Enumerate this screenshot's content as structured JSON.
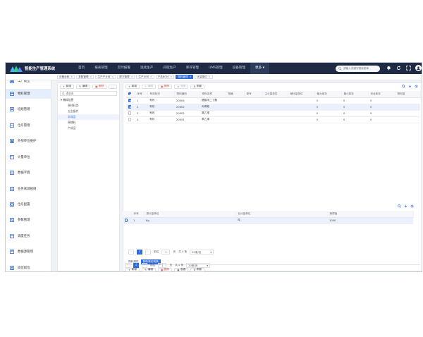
{
  "app": {
    "title": "智能生产管理系统"
  },
  "nav": [
    "首页",
    "报表管理",
    "实时报警",
    "连续生产",
    "间歇生产",
    "库存管理",
    "UMS管理",
    "设备管理",
    "更多"
  ],
  "search": {
    "placeholder": "请输入关键字搜索菜单"
  },
  "tabs": [
    {
      "label": "设备台帐"
    },
    {
      "label": "参数管理"
    },
    {
      "label": "生产产计划"
    },
    {
      "label": "配方管理"
    },
    {
      "label": "生产计划"
    },
    {
      "label": "产品BOM"
    },
    {
      "label": "物料管理"
    },
    {
      "label": "计量单位"
    }
  ],
  "sidebar": [
    {
      "label": "工厂模型"
    },
    {
      "label": "物料管理"
    },
    {
      "label": "班组管理"
    },
    {
      "label": "位号管理"
    },
    {
      "label": "外部单位维护"
    },
    {
      "label": "计量单位"
    },
    {
      "label": "数据字典"
    },
    {
      "label": "业务来源规则"
    },
    {
      "label": "位号配置"
    },
    {
      "label": "参数管理"
    },
    {
      "label": "调度任务"
    },
    {
      "label": "数据源管理"
    },
    {
      "label": "岗位职位"
    }
  ],
  "tree": {
    "toolbar": {
      "add": "新增",
      "edit": "编辑",
      "delete": "删除",
      "more": "..."
    },
    "search_placeholder": "请查询",
    "root": "物料信息",
    "nodes": [
      "原材料类",
      "五金备件",
      "半成品",
      "原辅料",
      "产成品"
    ]
  },
  "materials": {
    "toolbar": {
      "add": "新增",
      "edit": "编辑",
      "delete": "删除",
      "view": "查看",
      "refresh": "刷新"
    },
    "columns": [
      "序号",
      "有效标识",
      "物料编码",
      "物料名称",
      "规格",
      "型号",
      "主计量单位",
      "辅计量单位",
      "最大库存",
      "最小库存",
      "安全库存",
      "物料描"
    ],
    "rows": [
      {
        "no": "1",
        "status": "有效",
        "code": "20004",
        "name": "醋酸甲二丁酯",
        "max": "0",
        "min": "0",
        "safe": "0",
        "checked": true,
        "selected": false
      },
      {
        "no": "2",
        "status": "有效",
        "code": "20002",
        "name": "丙烯氰",
        "max": "0",
        "min": "0",
        "safe": "0",
        "checked": true,
        "selected": true
      },
      {
        "no": "3",
        "status": "有效",
        "code": "20002",
        "name": "氯乙烯",
        "max": "0",
        "min": "0",
        "safe": "0",
        "checked": false,
        "selected": false
      },
      {
        "no": "4",
        "status": "有效",
        "code": "20001",
        "name": "苯乙烯",
        "max": "0",
        "min": "0",
        "safe": "0",
        "checked": false,
        "selected": false
      }
    ],
    "pager": {
      "page": "1",
      "goto_label": "前往",
      "goto_value": "1",
      "page_unit": "页",
      "total": "共 4 条",
      "size": "20条/页"
    }
  },
  "subtabs": [
    "物料属性",
    "物料单位转换"
  ],
  "conversion": {
    "toolbar": {
      "add": "新增",
      "edit": "编辑",
      "delete": "删除",
      "view": "查看",
      "refresh": "刷新"
    },
    "columns": [
      "序号",
      "源计量单位",
      "目计量单位",
      "换算值"
    ],
    "rows": [
      {
        "no": "1",
        "from": "Kg",
        "to": "吨",
        "value": "1000",
        "checked": true
      }
    ],
    "pager": {
      "page": "1",
      "goto_label": "前往",
      "goto_value": "1",
      "page_unit": "页",
      "total": "共 1 条",
      "size": "20条/页"
    }
  },
  "colors": {
    "topbar": "#1f2a44",
    "accent": "#2f6bd9",
    "danger": "#d94a4a",
    "sidebar_icon": "#2f6bd9"
  }
}
